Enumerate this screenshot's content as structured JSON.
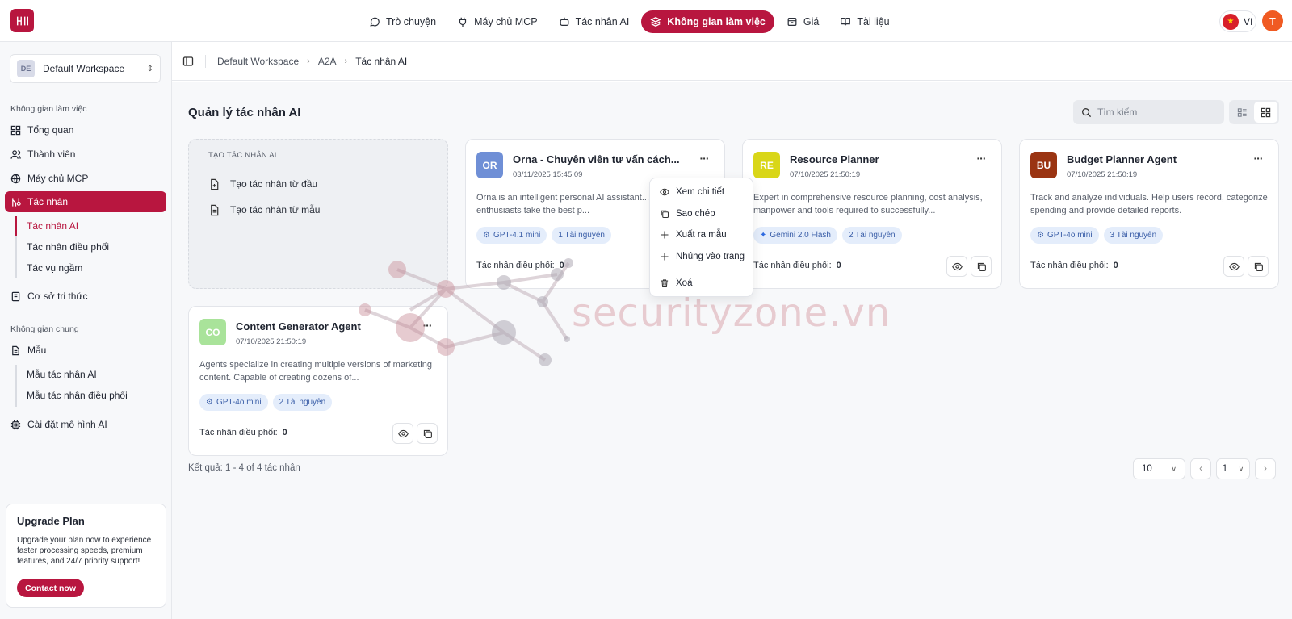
{
  "topnav": [
    {
      "label": "Trò chuyện",
      "icon": "chat-icon"
    },
    {
      "label": "Máy chủ MCP",
      "icon": "plug-icon"
    },
    {
      "label": "Tác nhân AI",
      "icon": "bot-icon"
    },
    {
      "label": "Không gian làm việc",
      "icon": "layers-icon",
      "active": true
    },
    {
      "label": "Giá",
      "icon": "box-icon"
    },
    {
      "label": "Tài liệu",
      "icon": "book-icon"
    }
  ],
  "lang": {
    "code": "VI"
  },
  "user": {
    "initial": "T"
  },
  "workspace": {
    "badge": "DE",
    "name": "Default Workspace"
  },
  "sidebar": {
    "section1": "Không gian làm việc",
    "overview": "Tổng quan",
    "members": "Thành viên",
    "mcp": "Máy chủ MCP",
    "agents": "Tác nhân",
    "sub_ai_agent": "Tác nhân AI",
    "sub_coordinator": "Tác nhân điều phối",
    "sub_background": "Tác vụ ngầm",
    "knowledge": "Cơ sở tri thức",
    "section2": "Không gian chung",
    "templates": "Mẫu",
    "sub_agent_templates": "Mẫu tác nhân AI",
    "sub_coord_templates": "Mẫu tác nhân điều phối",
    "ai_model_settings": "Cài đặt mô hình AI"
  },
  "upgrade": {
    "title": "Upgrade Plan",
    "text": "Upgrade your plan now to experience faster processing speeds, premium features, and 24/7 priority support!",
    "button": "Contact now"
  },
  "breadcrumb": [
    "Default Workspace",
    "A2A",
    "Tác nhân AI"
  ],
  "page": {
    "title": "Quản lý tác nhân AI",
    "search_placeholder": "Tìm kiếm"
  },
  "create": {
    "caption": "TẠO TÁC NHÂN AI",
    "from_scratch": "Tạo tác nhân từ đầu",
    "from_template": "Tạo tác nhân từ mẫu"
  },
  "coord_label": "Tác nhân điều phối:",
  "agents": [
    {
      "badge": "OR",
      "color": "#6f8fd6",
      "name": "Orna - Chuyên viên tư vấn cách...",
      "date": "03/11/2025 15:45:09",
      "desc": "Orna is an intelligent personal AI assistant... help aquarium enthusiasts take the best p...",
      "model": "GPT-4.1 mini",
      "model_icon": "openai-icon",
      "resources": "1 Tài nguyên",
      "coordinators": "0"
    },
    {
      "badge": "RE",
      "color": "#d9d618",
      "name": "Resource Planner",
      "date": "07/10/2025 21:50:19",
      "desc": "Expert in comprehensive resource planning, cost analysis, manpower and tools required to successfully...",
      "model": "Gemini 2.0 Flash",
      "model_icon": "gemini-icon",
      "resources": "2 Tài nguyên",
      "coordinators": "0"
    },
    {
      "badge": "BU",
      "color": "#9a3412",
      "name": "Budget Planner Agent",
      "date": "07/10/2025 21:50:19",
      "desc": "Track and analyze individuals. Help users record, categorize spending and provide detailed reports.",
      "model": "GPT-4o mini",
      "model_icon": "openai-icon",
      "resources": "3 Tài nguyên",
      "coordinators": "0"
    },
    {
      "badge": "CO",
      "color": "#a9e39a",
      "name": "Content Generator Agent",
      "date": "07/10/2025 21:50:19",
      "desc": "Agents specialize in creating multiple versions of marketing content. Capable of creating dozens of...",
      "model": "GPT-4o mini",
      "model_icon": "openai-icon",
      "resources": "2 Tài nguyên",
      "coordinators": "0"
    }
  ],
  "menu": {
    "view": "Xem chi tiết",
    "copy": "Sao chép",
    "export": "Xuất ra mẫu",
    "embed": "Nhúng vào trang",
    "delete": "Xoá"
  },
  "pagination": {
    "result": "Kết quả: 1 - 4 of 4 tác nhân",
    "page_size": "10",
    "page": "1"
  },
  "watermark": "securityzone.vn",
  "colors": {
    "accent": "#b8163f"
  }
}
